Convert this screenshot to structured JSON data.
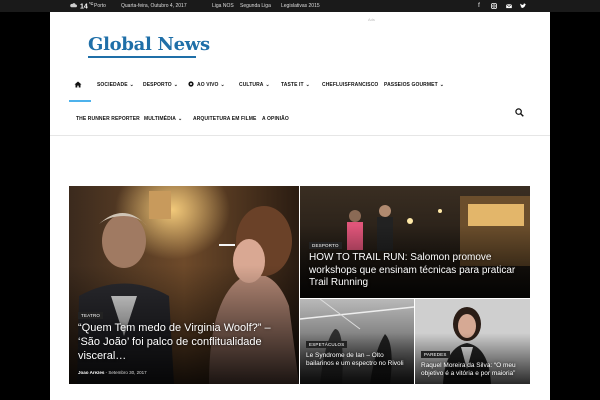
{
  "topbar": {
    "temperature": "14",
    "temp_unit": "C",
    "city": "Porto",
    "date": "Quarta-feira, Outubro 4, 2017",
    "links": [
      "Liga NOS",
      "Segunda Liga",
      "Legislativas 2015"
    ]
  },
  "social_icons": [
    "facebook-icon",
    "instagram-icon",
    "mail-icon",
    "twitter-icon"
  ],
  "logo": {
    "text": "Global News"
  },
  "ad_mark": "Ads",
  "nav": {
    "row1": [
      {
        "label": "Sociedade",
        "dropdown": true
      },
      {
        "label": "Desporto",
        "dropdown": true
      },
      {
        "label": "Ao Vivo",
        "dropdown": true
      },
      {
        "label": "Cultura",
        "dropdown": true
      },
      {
        "label": "Taste It",
        "dropdown": true
      },
      {
        "label": "ChefLuisFrancisco",
        "dropdown": false
      },
      {
        "label": "Passeios Gourmet",
        "dropdown": true
      }
    ],
    "row2": [
      {
        "label": "The Runner Reporter",
        "dropdown": false
      },
      {
        "label": "Multimédia",
        "dropdown": true
      },
      {
        "label": "Arquitetura em Filme",
        "dropdown": false
      },
      {
        "label": "A Opinião",
        "dropdown": false
      }
    ]
  },
  "featured": {
    "main": {
      "category": "Teatro",
      "title": "“Quem Tem medo de Virginia Woolf?” – ‘São João’ foi palco de conflitualidade visceral…",
      "author": "Joao Arezes",
      "date": "Setembro 30, 2017"
    },
    "top_right": {
      "category": "Desporto",
      "title": "HOW TO TRAIL RUN: Salomon promove workshops que ensinam técnicas para praticar Trail Running"
    },
    "bottom_mid": {
      "category": "Espetáculos",
      "title": "Le Syndrome de Ian – Olto bailarinos e um espectro no Rivoli"
    },
    "bottom_right": {
      "category": "Paredes",
      "title": "Raquel Moreira da Silva: “O meu objetivo é a vitória e por maioria”"
    }
  }
}
